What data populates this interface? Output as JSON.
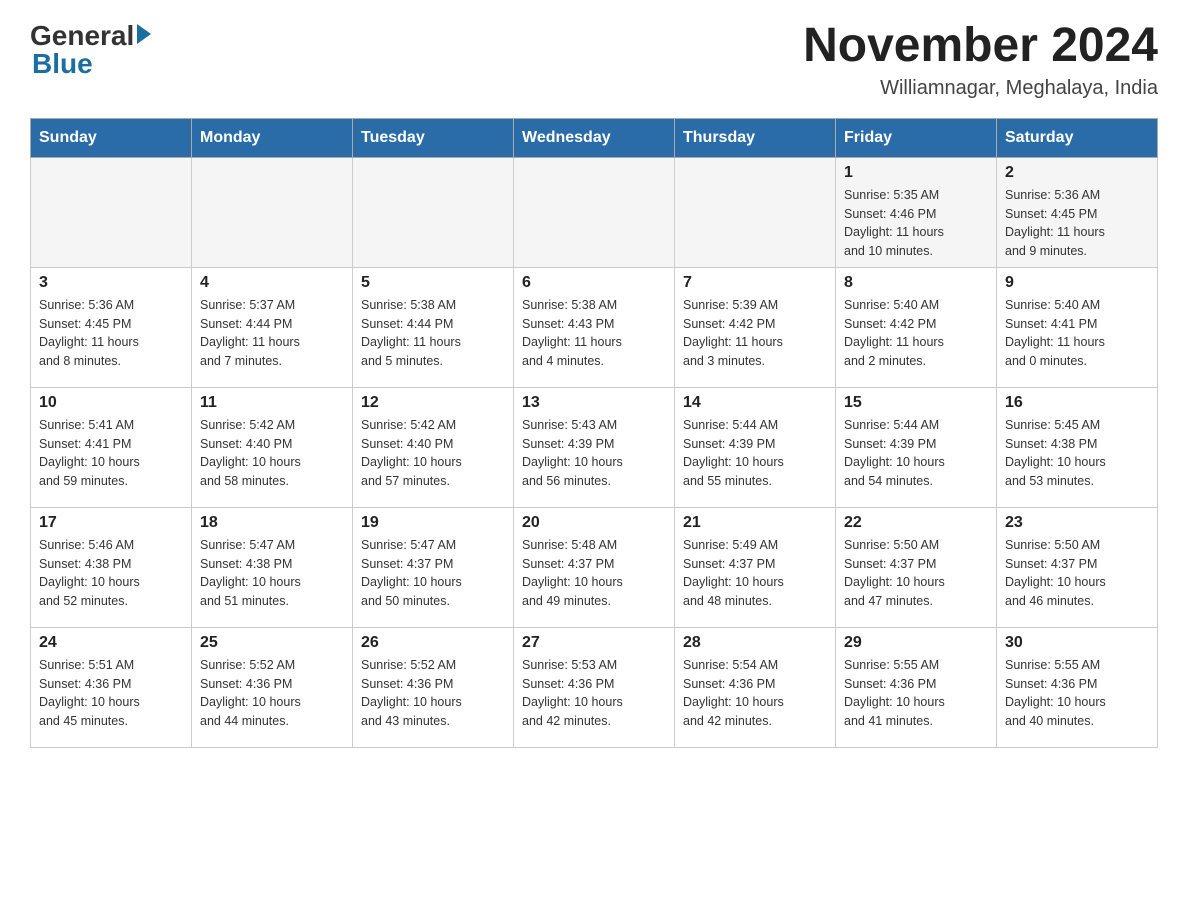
{
  "header": {
    "logo": {
      "general": "General",
      "blue": "Blue"
    },
    "title": "November 2024",
    "location": "Williamnagar, Meghalaya, India"
  },
  "days_of_week": [
    "Sunday",
    "Monday",
    "Tuesday",
    "Wednesday",
    "Thursday",
    "Friday",
    "Saturday"
  ],
  "weeks": [
    [
      {
        "day": "",
        "info": ""
      },
      {
        "day": "",
        "info": ""
      },
      {
        "day": "",
        "info": ""
      },
      {
        "day": "",
        "info": ""
      },
      {
        "day": "",
        "info": ""
      },
      {
        "day": "1",
        "info": "Sunrise: 5:35 AM\nSunset: 4:46 PM\nDaylight: 11 hours\nand 10 minutes."
      },
      {
        "day": "2",
        "info": "Sunrise: 5:36 AM\nSunset: 4:45 PM\nDaylight: 11 hours\nand 9 minutes."
      }
    ],
    [
      {
        "day": "3",
        "info": "Sunrise: 5:36 AM\nSunset: 4:45 PM\nDaylight: 11 hours\nand 8 minutes."
      },
      {
        "day": "4",
        "info": "Sunrise: 5:37 AM\nSunset: 4:44 PM\nDaylight: 11 hours\nand 7 minutes."
      },
      {
        "day": "5",
        "info": "Sunrise: 5:38 AM\nSunset: 4:44 PM\nDaylight: 11 hours\nand 5 minutes."
      },
      {
        "day": "6",
        "info": "Sunrise: 5:38 AM\nSunset: 4:43 PM\nDaylight: 11 hours\nand 4 minutes."
      },
      {
        "day": "7",
        "info": "Sunrise: 5:39 AM\nSunset: 4:42 PM\nDaylight: 11 hours\nand 3 minutes."
      },
      {
        "day": "8",
        "info": "Sunrise: 5:40 AM\nSunset: 4:42 PM\nDaylight: 11 hours\nand 2 minutes."
      },
      {
        "day": "9",
        "info": "Sunrise: 5:40 AM\nSunset: 4:41 PM\nDaylight: 11 hours\nand 0 minutes."
      }
    ],
    [
      {
        "day": "10",
        "info": "Sunrise: 5:41 AM\nSunset: 4:41 PM\nDaylight: 10 hours\nand 59 minutes."
      },
      {
        "day": "11",
        "info": "Sunrise: 5:42 AM\nSunset: 4:40 PM\nDaylight: 10 hours\nand 58 minutes."
      },
      {
        "day": "12",
        "info": "Sunrise: 5:42 AM\nSunset: 4:40 PM\nDaylight: 10 hours\nand 57 minutes."
      },
      {
        "day": "13",
        "info": "Sunrise: 5:43 AM\nSunset: 4:39 PM\nDaylight: 10 hours\nand 56 minutes."
      },
      {
        "day": "14",
        "info": "Sunrise: 5:44 AM\nSunset: 4:39 PM\nDaylight: 10 hours\nand 55 minutes."
      },
      {
        "day": "15",
        "info": "Sunrise: 5:44 AM\nSunset: 4:39 PM\nDaylight: 10 hours\nand 54 minutes."
      },
      {
        "day": "16",
        "info": "Sunrise: 5:45 AM\nSunset: 4:38 PM\nDaylight: 10 hours\nand 53 minutes."
      }
    ],
    [
      {
        "day": "17",
        "info": "Sunrise: 5:46 AM\nSunset: 4:38 PM\nDaylight: 10 hours\nand 52 minutes."
      },
      {
        "day": "18",
        "info": "Sunrise: 5:47 AM\nSunset: 4:38 PM\nDaylight: 10 hours\nand 51 minutes."
      },
      {
        "day": "19",
        "info": "Sunrise: 5:47 AM\nSunset: 4:37 PM\nDaylight: 10 hours\nand 50 minutes."
      },
      {
        "day": "20",
        "info": "Sunrise: 5:48 AM\nSunset: 4:37 PM\nDaylight: 10 hours\nand 49 minutes."
      },
      {
        "day": "21",
        "info": "Sunrise: 5:49 AM\nSunset: 4:37 PM\nDaylight: 10 hours\nand 48 minutes."
      },
      {
        "day": "22",
        "info": "Sunrise: 5:50 AM\nSunset: 4:37 PM\nDaylight: 10 hours\nand 47 minutes."
      },
      {
        "day": "23",
        "info": "Sunrise: 5:50 AM\nSunset: 4:37 PM\nDaylight: 10 hours\nand 46 minutes."
      }
    ],
    [
      {
        "day": "24",
        "info": "Sunrise: 5:51 AM\nSunset: 4:36 PM\nDaylight: 10 hours\nand 45 minutes."
      },
      {
        "day": "25",
        "info": "Sunrise: 5:52 AM\nSunset: 4:36 PM\nDaylight: 10 hours\nand 44 minutes."
      },
      {
        "day": "26",
        "info": "Sunrise: 5:52 AM\nSunset: 4:36 PM\nDaylight: 10 hours\nand 43 minutes."
      },
      {
        "day": "27",
        "info": "Sunrise: 5:53 AM\nSunset: 4:36 PM\nDaylight: 10 hours\nand 42 minutes."
      },
      {
        "day": "28",
        "info": "Sunrise: 5:54 AM\nSunset: 4:36 PM\nDaylight: 10 hours\nand 42 minutes."
      },
      {
        "day": "29",
        "info": "Sunrise: 5:55 AM\nSunset: 4:36 PM\nDaylight: 10 hours\nand 41 minutes."
      },
      {
        "day": "30",
        "info": "Sunrise: 5:55 AM\nSunset: 4:36 PM\nDaylight: 10 hours\nand 40 minutes."
      }
    ]
  ]
}
